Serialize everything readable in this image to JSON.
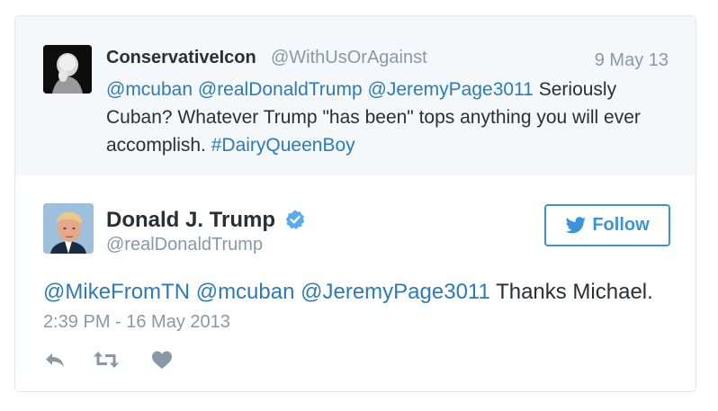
{
  "parent_tweet": {
    "display_name": "ConservativeIcon",
    "handle": "@WithUsOrAgainst",
    "date": "9 May 13",
    "mentions": [
      "@mcuban",
      "@realDonaldTrump",
      "@JeremyPage3011"
    ],
    "text": "Seriously Cuban? Whatever Trump \"has been\" tops anything you will ever accomplish.",
    "hashtag": "#DairyQueenBoy"
  },
  "main_tweet": {
    "display_name": "Donald J. Trump",
    "handle": "@realDonaldTrump",
    "follow_label": "Follow",
    "mentions": [
      "@MikeFromTN",
      "@mcuban",
      "@JeremyPage3011"
    ],
    "text": "Thanks Michael.",
    "timestamp": "2:39 PM - 16 May 2013"
  },
  "colors": {
    "link": "#2b7bb9",
    "follow": "#3b94d9",
    "muted": "#8899a6",
    "parent_bg": "#f5f8fa"
  },
  "icons": [
    "reply-icon",
    "retweet-icon",
    "like-icon",
    "verified-icon",
    "twitter-bird-icon"
  ]
}
